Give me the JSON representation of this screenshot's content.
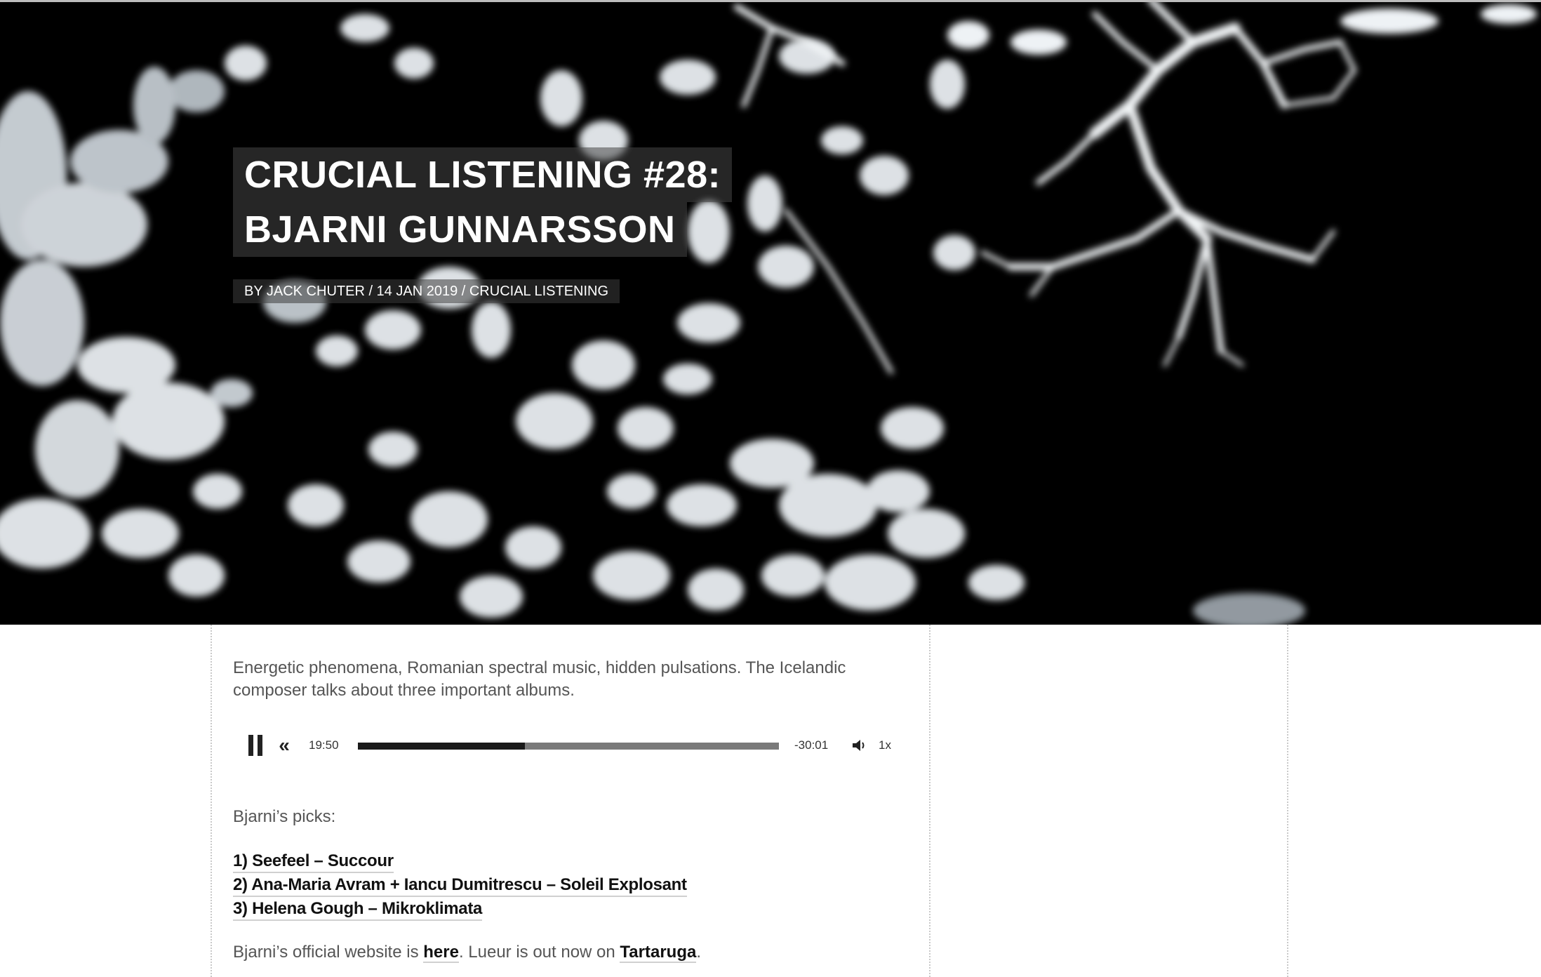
{
  "hero": {
    "title_line1": "CRUCIAL LISTENING #28:",
    "title_line2": "BJARNI GUNNARSSON",
    "byline": "BY JACK CHUTER / 14 JAN 2019 / CRUCIAL LISTENING"
  },
  "article": {
    "intro": "Energetic phenomena, Romanian spectral music, hidden pulsations. The Icelandic composer talks about three important albums.",
    "picks_label": "Bjarni’s picks:",
    "picks": [
      "1) Seefeel – Succour",
      "2) Ana-Maria Avram + Iancu Dumitrescu – Soleil Explosant",
      "3) Helena Gough – Mikroklimata"
    ],
    "footer_before": "Bjarni’s official website is ",
    "footer_link1": "here",
    "footer_middle": ". Lueur is out now on ",
    "footer_link2": "Tartaruga",
    "footer_after": "."
  },
  "player": {
    "current_time": "19:50",
    "remaining_time": "-30:01",
    "speed": "1x",
    "progress_fraction": 0.397,
    "pause_icon": "pause-icon",
    "rewind_icon": "rewind-icon",
    "volume_icon": "volume-icon"
  }
}
